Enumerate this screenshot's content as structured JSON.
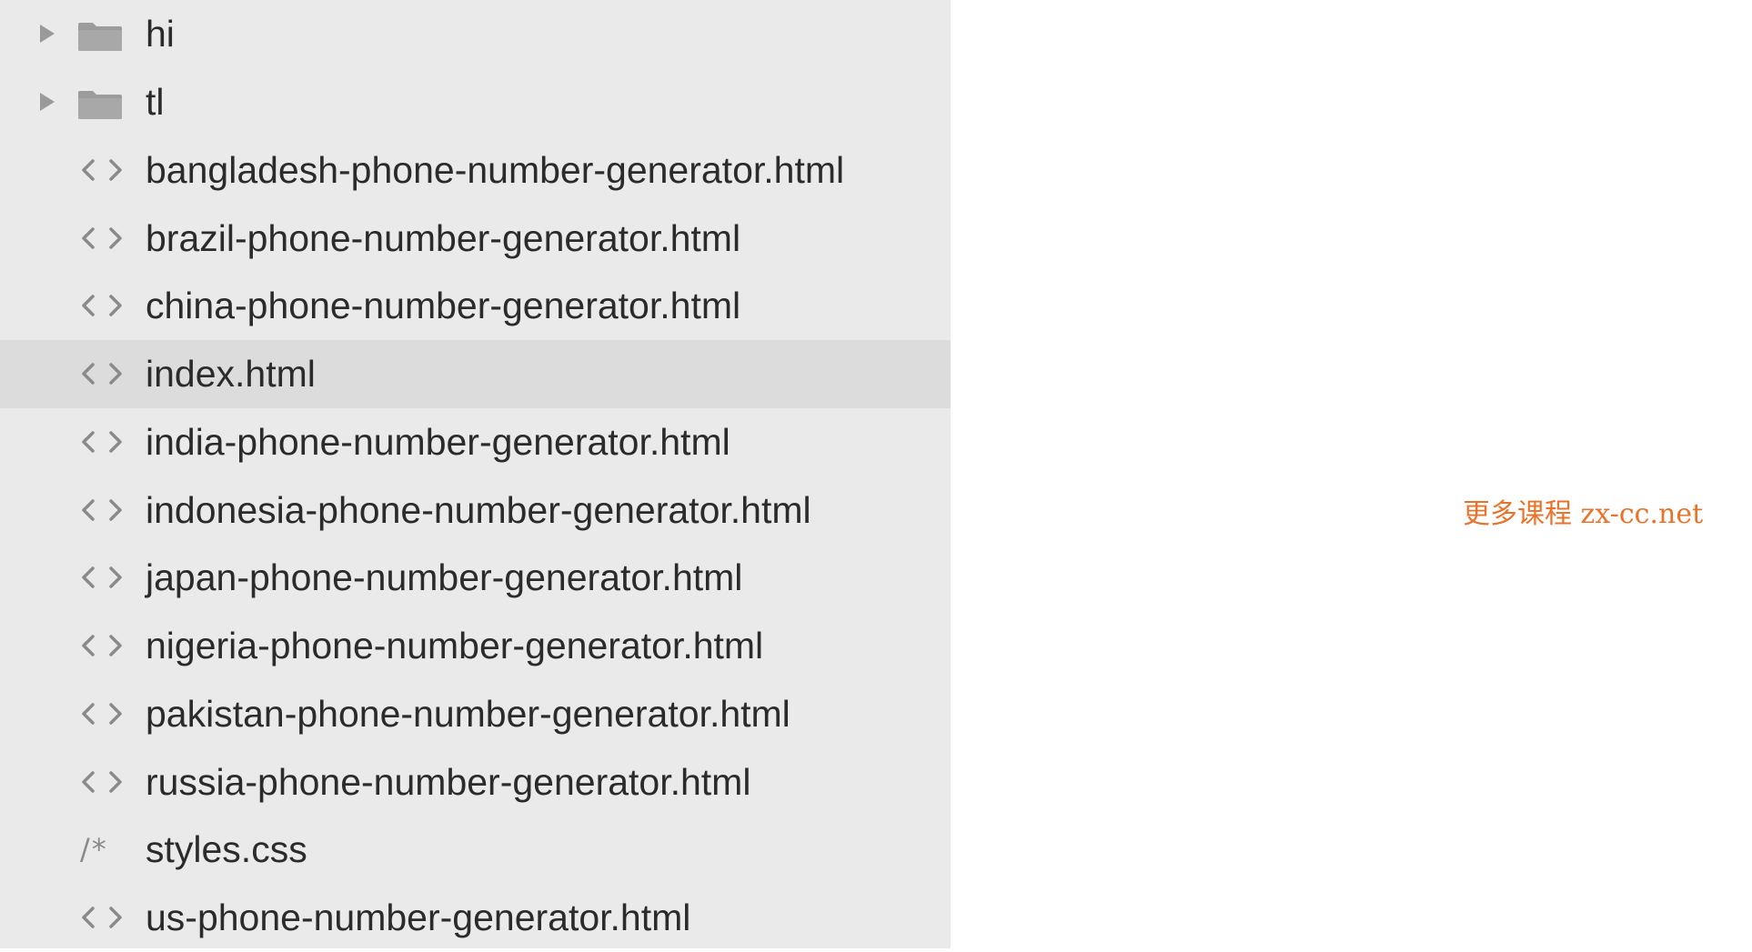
{
  "file_tree": {
    "items": [
      {
        "label": "hi",
        "type": "folder",
        "icon": "folder-icon"
      },
      {
        "label": "tl",
        "type": "folder",
        "icon": "folder-icon"
      },
      {
        "label": "bangladesh-phone-number-generator.html",
        "type": "html",
        "icon": "code-file-icon"
      },
      {
        "label": "brazil-phone-number-generator.html",
        "type": "html",
        "icon": "code-file-icon"
      },
      {
        "label": "china-phone-number-generator.html",
        "type": "html",
        "icon": "code-file-icon"
      },
      {
        "label": "index.html",
        "type": "html",
        "icon": "code-file-icon",
        "selected": true
      },
      {
        "label": "india-phone-number-generator.html",
        "type": "html",
        "icon": "code-file-icon"
      },
      {
        "label": "indonesia-phone-number-generator.html",
        "type": "html",
        "icon": "code-file-icon"
      },
      {
        "label": "japan-phone-number-generator.html",
        "type": "html",
        "icon": "code-file-icon"
      },
      {
        "label": "nigeria-phone-number-generator.html",
        "type": "html",
        "icon": "code-file-icon"
      },
      {
        "label": "pakistan-phone-number-generator.html",
        "type": "html",
        "icon": "code-file-icon"
      },
      {
        "label": "russia-phone-number-generator.html",
        "type": "html",
        "icon": "code-file-icon"
      },
      {
        "label": "styles.css",
        "type": "css",
        "icon": "css-file-icon",
        "icon_glyph": "/*"
      },
      {
        "label": "us-phone-number-generator.html",
        "type": "html",
        "icon": "code-file-icon"
      }
    ]
  },
  "watermark": {
    "text": "更多课程 zx-cc.net",
    "color": "#e8732a"
  },
  "colors": {
    "sidebar_background": "#eaeaea",
    "selected_row": "#dcdcdc",
    "label_text": "#2b2b2b",
    "icon_gray": "#8a8a8a"
  }
}
